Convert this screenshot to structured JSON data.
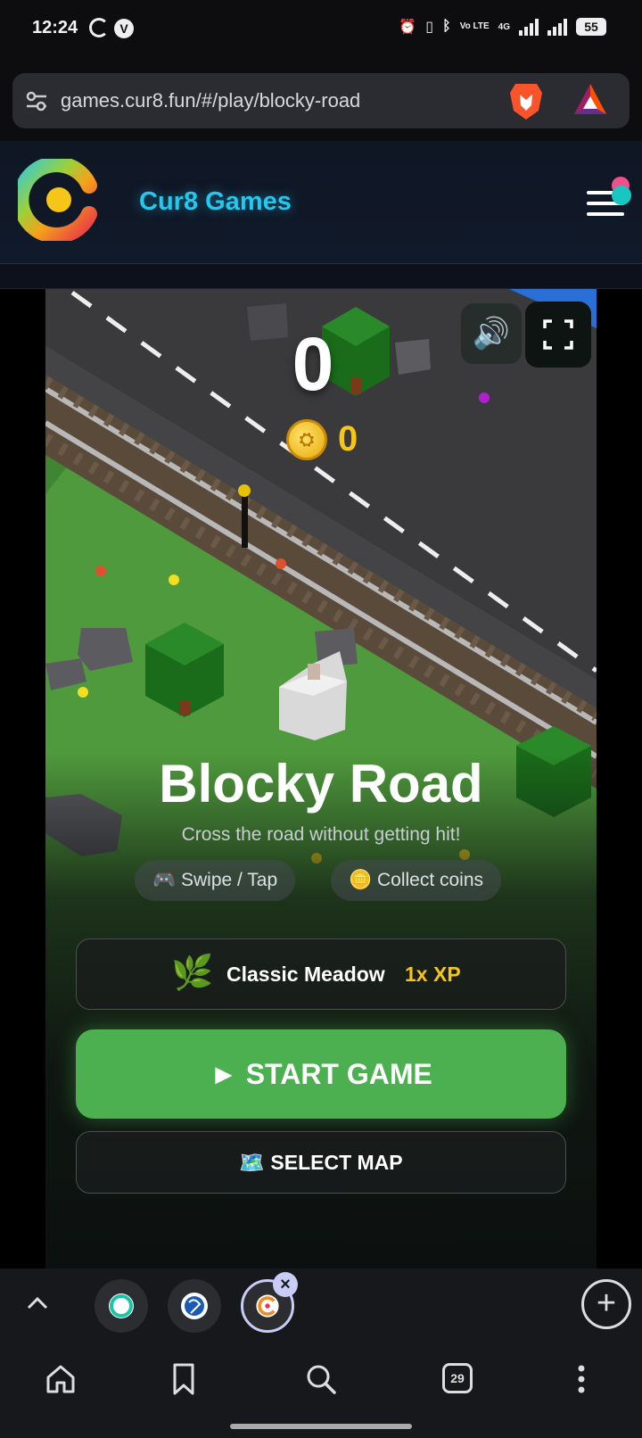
{
  "status_bar": {
    "time": "12:24",
    "net_label": "Vo LTE",
    "net_4g": "4G",
    "battery": "55"
  },
  "browser": {
    "url": "games.cur8.fun/#/play/blocky-road",
    "tune_icon": "tune-icon",
    "brave_icon": "brave-lion-icon",
    "rewards_icon": "bat-triangle-icon"
  },
  "site": {
    "title": "Cur8 Games",
    "menu_icon": "hamburger-menu-icon"
  },
  "game": {
    "score": "0",
    "coins": "0",
    "title": "Blocky Road",
    "subtitle": "Cross the road without getting hit!",
    "hints": [
      "🎮 Swipe / Tap",
      "🪙 Collect coins"
    ],
    "map": {
      "icon": "🌿",
      "name": "Classic Meadow",
      "xp": "1x XP"
    },
    "start_label": "► START GAME",
    "select_map_label": "🗺️ SELECT MAP",
    "colors": {
      "grass": "#4f9a3c",
      "road": "#3a3a3c",
      "start_button": "#4caf50",
      "coin_text": "#f5c518"
    }
  },
  "tab_strip": {
    "tab_close": "×",
    "new_tab": "+"
  },
  "bottom_nav": {
    "tabs_count": "29"
  }
}
